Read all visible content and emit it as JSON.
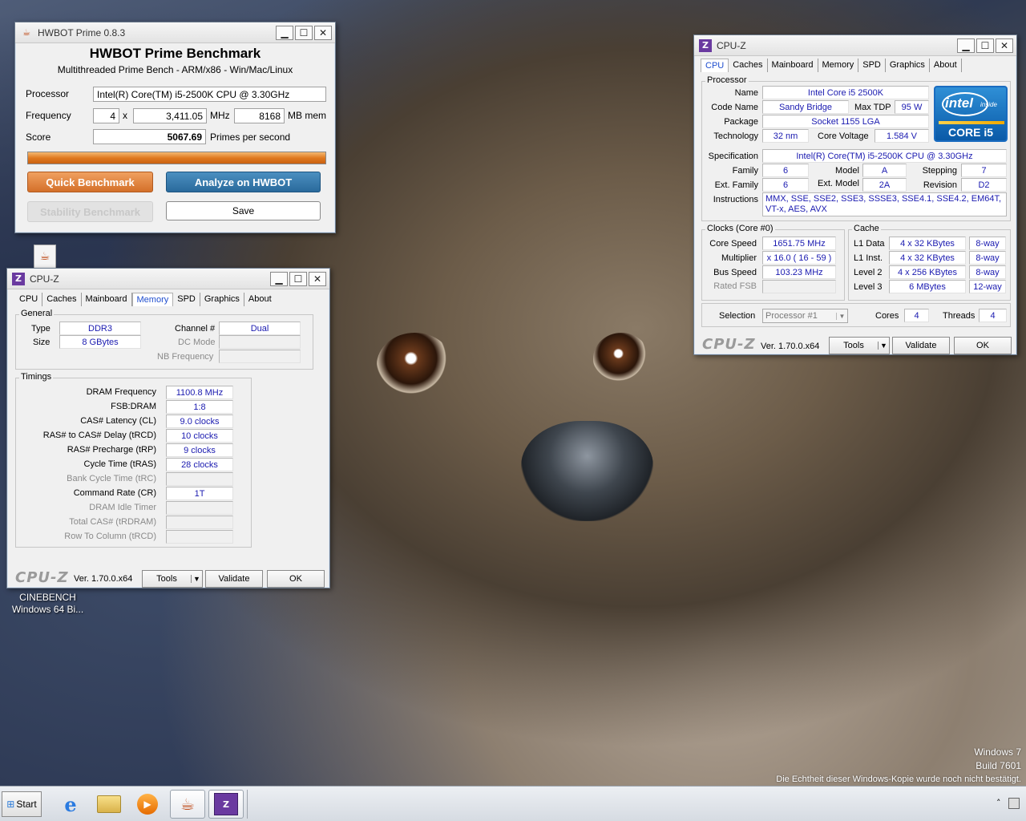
{
  "desktop": {
    "cinebench_icon_label": "CINEBENCH\nWindows 64 Bi...",
    "watermark_line1": "Windows 7",
    "watermark_line2": "Build 7601",
    "watermark_line3": "Die Echtheit dieser Windows-Kopie wurde noch nicht bestätigt."
  },
  "hwbot": {
    "window_title": "HWBOT Prime 0.8.3",
    "heading": "HWBOT Prime Benchmark",
    "subheading": "Multithreaded Prime Bench - ARM/x86 - Win/Mac/Linux",
    "processor_label": "Processor",
    "processor_value": "Intel(R) Core(TM) i5-2500K CPU @ 3.30GHz",
    "frequency_label": "Frequency",
    "threads": "4",
    "x_label": "x",
    "mhz_value": "3,411.05",
    "mhz_unit": "MHz",
    "mem_value": "8168",
    "mem_unit": "MB mem",
    "score_label": "Score",
    "score_value": "5067.69",
    "score_unit": "Primes per second",
    "progress": 1.0,
    "quick_benchmark": "Quick Benchmark",
    "analyze": "Analyze on HWBOT",
    "stability": "Stability Benchmark",
    "save": "Save"
  },
  "cpuz_memory": {
    "window_title": "CPU-Z",
    "tabs": [
      "CPU",
      "Caches",
      "Mainboard",
      "Memory",
      "SPD",
      "Graphics",
      "About"
    ],
    "active_tab": "Memory",
    "general_title": "General",
    "type_label": "Type",
    "type_value": "DDR3",
    "channel_label": "Channel #",
    "channel_value": "Dual",
    "size_label": "Size",
    "size_value": "8 GBytes",
    "dc_mode_label": "DC Mode",
    "nb_freq_label": "NB Frequency",
    "timings_title": "Timings",
    "timings": [
      {
        "label": "DRAM Frequency",
        "value": "1100.8 MHz",
        "enabled": true
      },
      {
        "label": "FSB:DRAM",
        "value": "1:8",
        "enabled": true
      },
      {
        "label": "CAS# Latency (CL)",
        "value": "9.0 clocks",
        "enabled": true
      },
      {
        "label": "RAS# to CAS# Delay (tRCD)",
        "value": "10 clocks",
        "enabled": true
      },
      {
        "label": "RAS# Precharge (tRP)",
        "value": "9 clocks",
        "enabled": true
      },
      {
        "label": "Cycle Time (tRAS)",
        "value": "28 clocks",
        "enabled": true
      },
      {
        "label": "Bank Cycle Time (tRC)",
        "value": "",
        "enabled": false
      },
      {
        "label": "Command Rate (CR)",
        "value": "1T",
        "enabled": true
      },
      {
        "label": "DRAM Idle Timer",
        "value": "",
        "enabled": false
      },
      {
        "label": "Total CAS# (tRDRAM)",
        "value": "",
        "enabled": false
      },
      {
        "label": "Row To Column (tRCD)",
        "value": "",
        "enabled": false
      }
    ],
    "brand": "CPU-Z",
    "version": "Ver. 1.70.0.x64",
    "tools": "Tools",
    "validate": "Validate",
    "ok": "OK"
  },
  "cpuz_cpu": {
    "window_title": "CPU-Z",
    "tabs": [
      "CPU",
      "Caches",
      "Mainboard",
      "Memory",
      "SPD",
      "Graphics",
      "About"
    ],
    "active_tab": "CPU",
    "processor_title": "Processor",
    "name_label": "Name",
    "name_value": "Intel Core i5 2500K",
    "codename_label": "Code Name",
    "codename_value": "Sandy Bridge",
    "maxtdp_label": "Max TDP",
    "maxtdp_value": "95 W",
    "package_label": "Package",
    "package_value": "Socket 1155 LGA",
    "technology_label": "Technology",
    "technology_value": "32 nm",
    "corevoltage_label": "Core Voltage",
    "corevoltage_value": "1.584 V",
    "spec_label": "Specification",
    "spec_value": "Intel(R) Core(TM) i5-2500K CPU @ 3.30GHz",
    "family_label": "Family",
    "family_value": "6",
    "model_label": "Model",
    "model_value": "A",
    "stepping_label": "Stepping",
    "stepping_value": "7",
    "extfamily_label": "Ext. Family",
    "extfamily_value": "6",
    "extmodel_label": "Ext. Model",
    "extmodel_value": "2A",
    "revision_label": "Revision",
    "revision_value": "D2",
    "instructions_label": "Instructions",
    "instructions_line1": "MMX, SSE, SSE2, SSE3, SSSE3, SSE4.1, SSE4.2, EM64T,",
    "instructions_line2": "VT-x, AES, AVX",
    "logo_intel": "intel",
    "logo_inside": "inside",
    "logo_core": "CORE i5",
    "clocks_title": "Clocks (Core #0)",
    "corespeed_label": "Core Speed",
    "corespeed_value": "1651.75 MHz",
    "multiplier_label": "Multiplier",
    "multiplier_value": "x 16.0 ( 16 - 59 )",
    "busspeed_label": "Bus Speed",
    "busspeed_value": "103.23 MHz",
    "ratedfsb_label": "Rated FSB",
    "cache_title": "Cache",
    "cache_rows": [
      {
        "label": "L1 Data",
        "size": "4 x 32 KBytes",
        "way": "8-way"
      },
      {
        "label": "L1 Inst.",
        "size": "4 x 32 KBytes",
        "way": "8-way"
      },
      {
        "label": "Level 2",
        "size": "4 x 256 KBytes",
        "way": "8-way"
      },
      {
        "label": "Level 3",
        "size": "6 MBytes",
        "way": "12-way"
      }
    ],
    "selection_label": "Selection",
    "selection_value": "Processor #1",
    "cores_label": "Cores",
    "cores_value": "4",
    "threads_label": "Threads",
    "threads_value": "4",
    "brand": "CPU-Z",
    "version": "Ver. 1.70.0.x64",
    "tools": "Tools",
    "validate": "Validate",
    "ok": "OK"
  },
  "taskbar": {
    "start_label": "Start"
  }
}
